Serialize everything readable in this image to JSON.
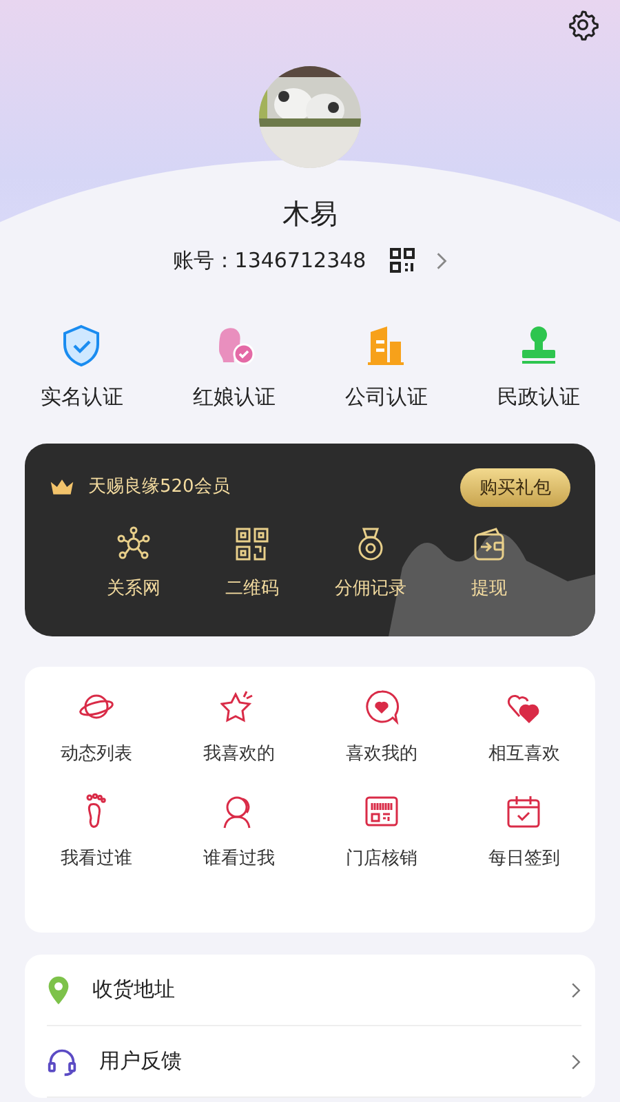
{
  "profile": {
    "name": "木易",
    "account_label": "账号：",
    "account": "1346712348"
  },
  "certifications": [
    {
      "label": "实名认证"
    },
    {
      "label": "红娘认证"
    },
    {
      "label": "公司认证"
    },
    {
      "label": "民政认证"
    }
  ],
  "membership": {
    "title": "天赐良缘520会员",
    "button": "购买礼包",
    "items": [
      {
        "label": "关系网"
      },
      {
        "label": "二维码"
      },
      {
        "label": "分佣记录"
      },
      {
        "label": "提现"
      }
    ]
  },
  "features": [
    {
      "label": "动态列表"
    },
    {
      "label": "我喜欢的"
    },
    {
      "label": "喜欢我的"
    },
    {
      "label": "相互喜欢"
    },
    {
      "label": "我看过谁"
    },
    {
      "label": "谁看过我"
    },
    {
      "label": "门店核销"
    },
    {
      "label": "每日签到"
    }
  ],
  "menu": [
    {
      "label": "收货地址"
    },
    {
      "label": "用户反馈"
    }
  ]
}
